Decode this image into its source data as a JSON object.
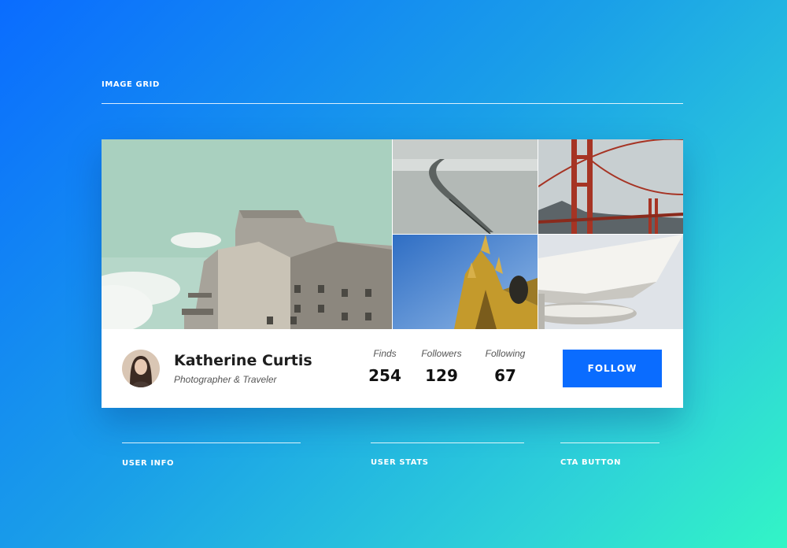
{
  "header": {
    "image_grid_label": "IMAGE GRID"
  },
  "profile": {
    "name": "Katherine Curtis",
    "subtitle": "Photographer & Traveler"
  },
  "stats": [
    {
      "label": "Finds",
      "value": "254"
    },
    {
      "label": "Followers",
      "value": "129"
    },
    {
      "label": "Following",
      "value": "67"
    }
  ],
  "cta": {
    "follow_label": "FOLLOW"
  },
  "annotations": {
    "user_info": "USER INFO",
    "user_stats": "USER STATS",
    "cta_button": "CTA BUTTON"
  },
  "colors": {
    "accent": "#0a6cff",
    "background_start": "#0a6cff",
    "background_end": "#32f5c6"
  },
  "images": [
    {
      "name": "concrete-building-photo"
    },
    {
      "name": "long-bridge-photo"
    },
    {
      "name": "golden-gate-bridge-photo"
    },
    {
      "name": "gothic-cathedral-photo"
    },
    {
      "name": "modern-architecture-photo"
    }
  ]
}
